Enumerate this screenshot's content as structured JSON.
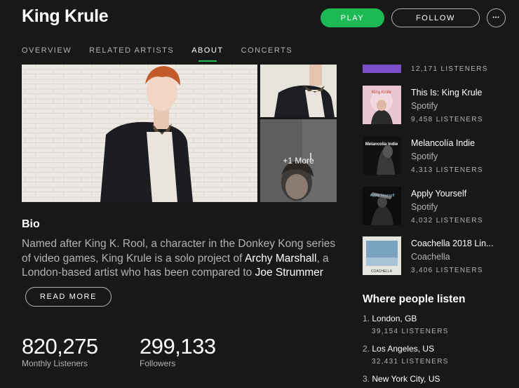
{
  "header": {
    "artist_name": "King Krule",
    "play_label": "PLAY",
    "follow_label": "FOLLOW",
    "more_label": "•••"
  },
  "tabs": [
    {
      "label": "OVERVIEW"
    },
    {
      "label": "RELATED ARTISTS"
    },
    {
      "label": "ABOUT"
    },
    {
      "label": "CONCERTS"
    }
  ],
  "gallery": {
    "more_label": "+1 More"
  },
  "bio": {
    "heading": "Bio",
    "part1": "Named after King K. Rool, a character in the Donkey Kong series of video games, King Krule is a solo project of ",
    "link1": "Archy Marshall",
    "part2": ", a London-based artist who has been compared to ",
    "link2": "Joe Strummer",
    "read_more_label": "READ MORE"
  },
  "stats": {
    "monthly_listeners_value": "820,275",
    "monthly_listeners_label": "Monthly Listeners",
    "followers_value": "299,133",
    "followers_label": "Followers"
  },
  "playlists_top_partial": {
    "listeners": "12,171 LISTENERS"
  },
  "playlists": [
    {
      "title": "This Is: King Krule",
      "owner": "Spotify",
      "listeners": "9,458 LISTENERS",
      "cover_text": "King Krule"
    },
    {
      "title": "Melancolía Indie",
      "owner": "Spotify",
      "listeners": "4,313 LISTENERS",
      "cover_text": "Melancolía Indie"
    },
    {
      "title": "Apply Yourself",
      "owner": "Spotify",
      "listeners": "4,032 LISTENERS",
      "cover_text": "Apply Yourself"
    },
    {
      "title": "Coachella 2018 Lin...",
      "owner": "Coachella",
      "listeners": "3,406 LISTENERS",
      "cover_text": "COACHELLA"
    }
  ],
  "where": {
    "heading": "Where people listen",
    "cities": [
      {
        "index": "1.",
        "name": "London, GB",
        "listeners": "39,154 LISTENERS"
      },
      {
        "index": "2.",
        "name": "Los Angeles, US",
        "listeners": "32,431 LISTENERS"
      },
      {
        "index": "3.",
        "name": "New York City, US",
        "listeners": ""
      }
    ]
  },
  "colors": {
    "accent": "#1db954",
    "background": "#181818",
    "muted_text": "#b3b3b3"
  }
}
